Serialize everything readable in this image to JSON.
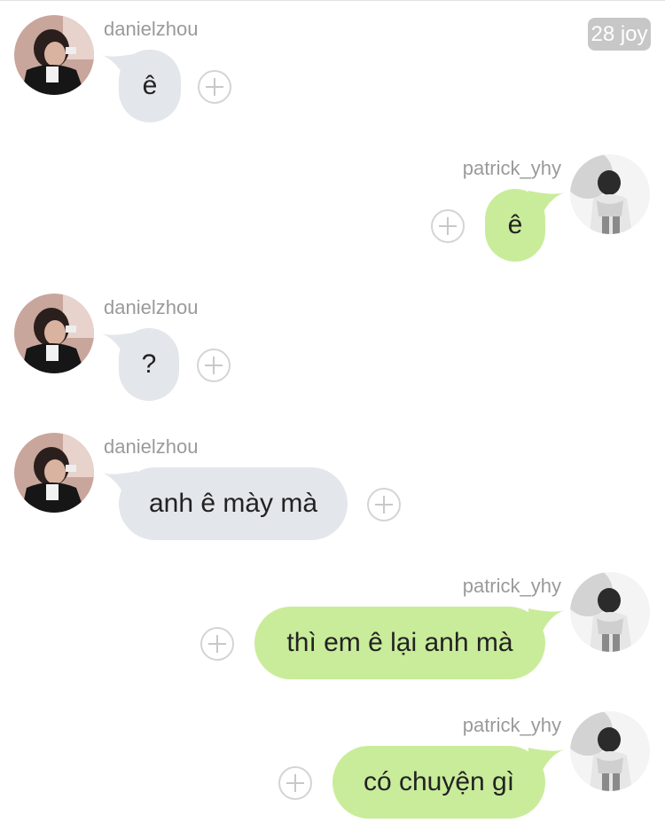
{
  "header": {
    "date_badge": "28 joy"
  },
  "messages": [
    {
      "sender": "danielzhou",
      "text": "ê",
      "direction": "incoming"
    },
    {
      "sender": "patrick_yhy",
      "text": "ê",
      "direction": "outgoing"
    },
    {
      "sender": "danielzhou",
      "text": "?",
      "direction": "incoming"
    },
    {
      "sender": "danielzhou",
      "text": "anh ê mày mà",
      "direction": "incoming"
    },
    {
      "sender": "patrick_yhy",
      "text": "thì em ê lại anh mà",
      "direction": "outgoing"
    },
    {
      "sender": "patrick_yhy",
      "text": "có chuyện gì",
      "direction": "outgoing"
    }
  ],
  "icons": {
    "reaction": "add-reaction-icon",
    "incoming_avatar": "avatar-photo",
    "outgoing_avatar": "avatar-photo"
  },
  "colors": {
    "incoming_bubble": "#e3e6ea",
    "outgoing_bubble": "#c9ec9a",
    "sender_name": "#9a9a9a",
    "badge": "#c7c7c7"
  }
}
